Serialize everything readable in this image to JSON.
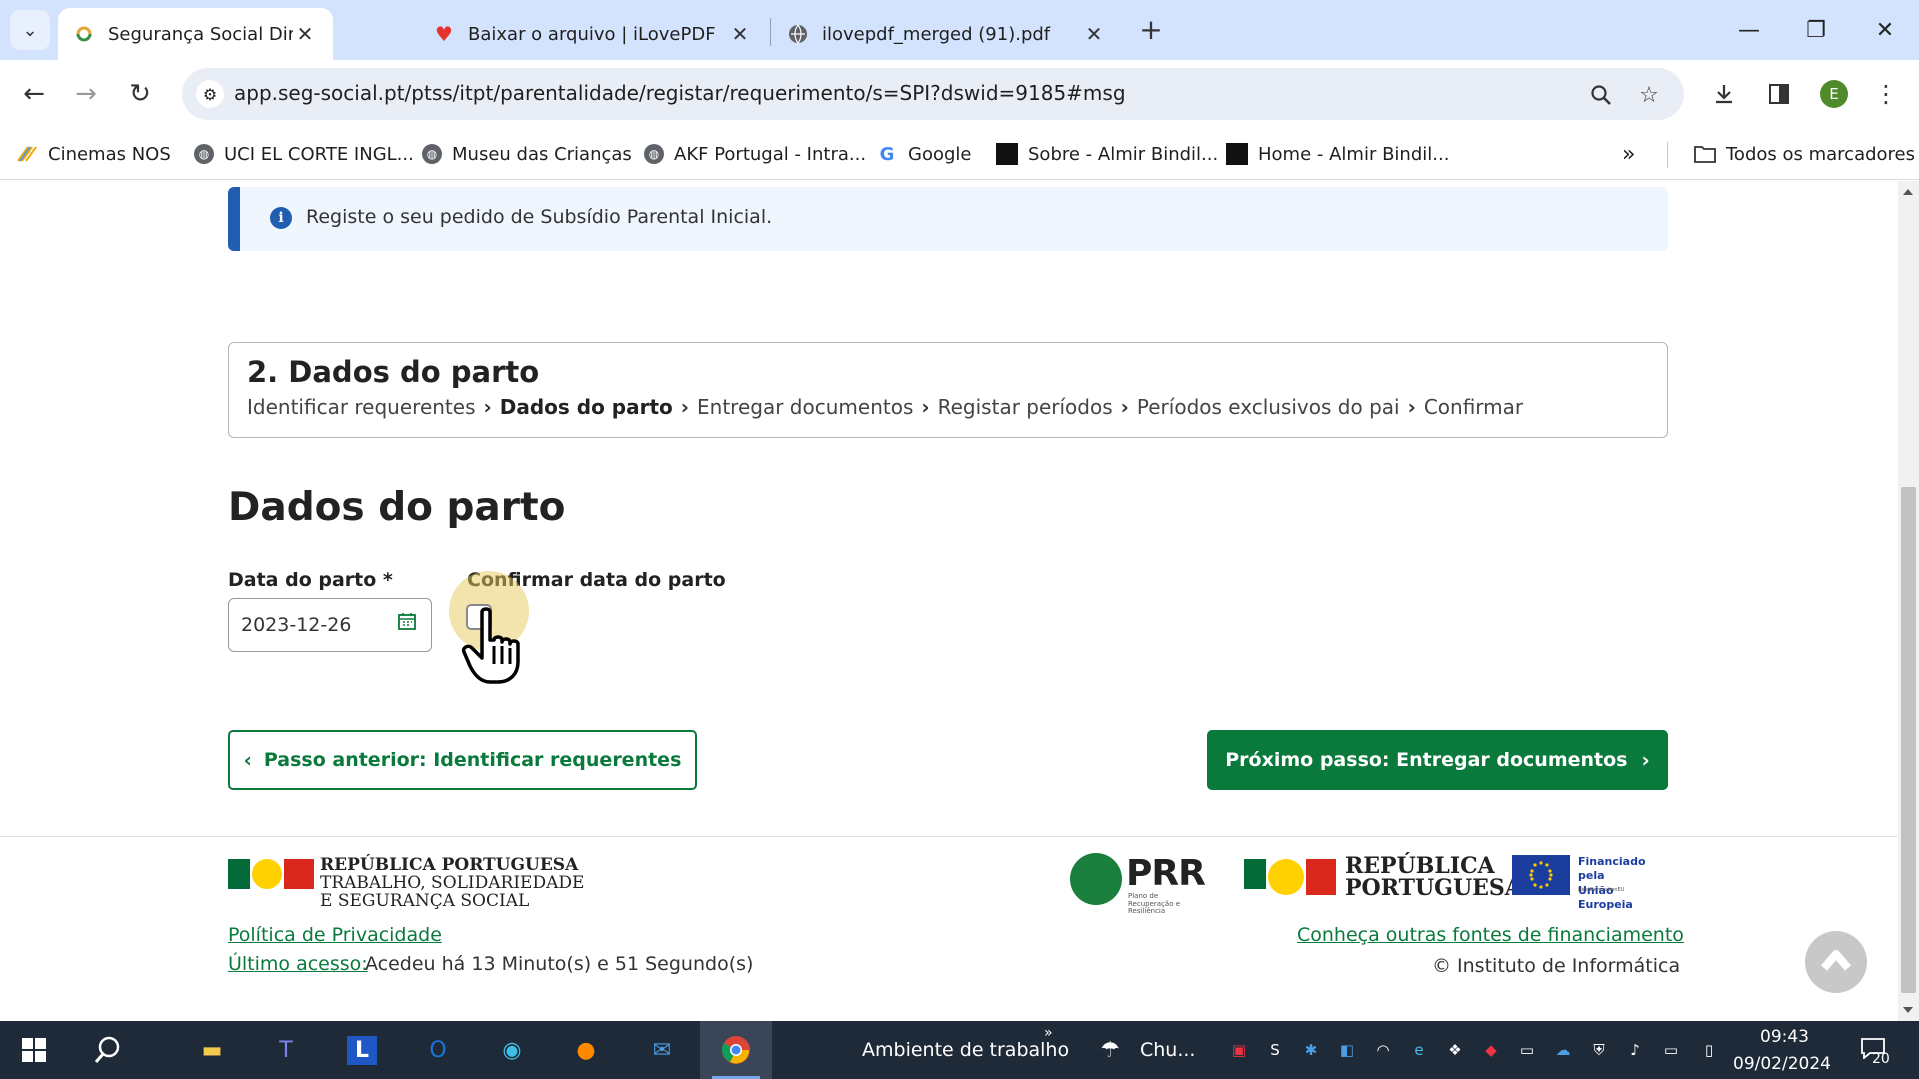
{
  "browser": {
    "tabs": [
      {
        "title": "Segurança Social Direta",
        "active": true,
        "favicon": "seg-social-icon"
      },
      {
        "title": "Baixar o arquivo | iLovePDF",
        "active": false,
        "favicon": "ilovepdf-heart-icon"
      },
      {
        "title": "ilovepdf_merged (91).pdf",
        "active": false,
        "favicon": "globe-icon"
      }
    ],
    "url": "app.seg-social.pt/ptss/itpt/parentalidade/registar/requerimento/s=SPI?dswid=9185#msg",
    "profile_initial": "E",
    "bookmarks": [
      {
        "label": "Cinemas NOS",
        "icon": "nos-icon"
      },
      {
        "label": "UCI EL CORTE INGL...",
        "icon": "globe-icon"
      },
      {
        "label": "Museu das Crianças",
        "icon": "globe-icon"
      },
      {
        "label": "AKF Portugal - Intra...",
        "icon": "globe-icon"
      },
      {
        "label": "Google",
        "icon": "google-icon"
      },
      {
        "label": "Sobre - Almir Bindil...",
        "icon": "dark-square-icon"
      },
      {
        "label": "Home - Almir Bindil...",
        "icon": "dark-square-icon"
      }
    ],
    "all_bookmarks_label": "Todos os marcadores"
  },
  "page": {
    "info_message": "Registe o seu pedido de Subsídio Parental Inicial.",
    "step_title": "2. Dados do parto",
    "breadcrumb": [
      {
        "label": "Identificar requerentes",
        "current": false
      },
      {
        "label": "Dados do parto",
        "current": true
      },
      {
        "label": "Entregar documentos",
        "current": false
      },
      {
        "label": "Registar períodos",
        "current": false
      },
      {
        "label": "Períodos exclusivos do pai",
        "current": false
      },
      {
        "label": "Confirmar",
        "current": false
      }
    ],
    "section_title": "Dados do parto",
    "birth_date": {
      "label": "Data do parto *",
      "value": "2023-12-26"
    },
    "confirm_date": {
      "label": "Confirmar data do parto",
      "checked": false
    },
    "prev_button": "Passo anterior: Identificar requerentes",
    "next_button": "Próximo passo: Entregar documentos",
    "colors": {
      "primary_green": "#0a7a3c",
      "info_blue": "#1f5eb0"
    }
  },
  "footer": {
    "left_logo": {
      "line1": "REPÚBLICA PORTUGUESA",
      "line2": "TRABALHO, SOLIDARIEDADE",
      "line3": "E SEGURANÇA SOCIAL"
    },
    "prr": {
      "name": "PRR",
      "subtitle": "Plano de Recuperação e Resiliência"
    },
    "rp_logo": {
      "line1": "REPÚBLICA",
      "line2": "PORTUGUESA"
    },
    "eu": {
      "line1": "Financiado pela",
      "line2": "União Europeia",
      "sub": "NextGenerationEU"
    },
    "privacy_link": "Política de Privacidade",
    "last_access_label": "Último acesso:",
    "last_access_value": "Acedeu há 13 Minuto(s) e 51 Segundo(s)",
    "funding_link": "Conheça outras fontes de financiamento",
    "copyright": "© Instituto de Informática"
  },
  "taskbar": {
    "desktop_label": "Ambiente de trabalho",
    "weather_label": "Chu...",
    "time": "09:43",
    "date": "09/02/2024",
    "notifications": "20"
  }
}
